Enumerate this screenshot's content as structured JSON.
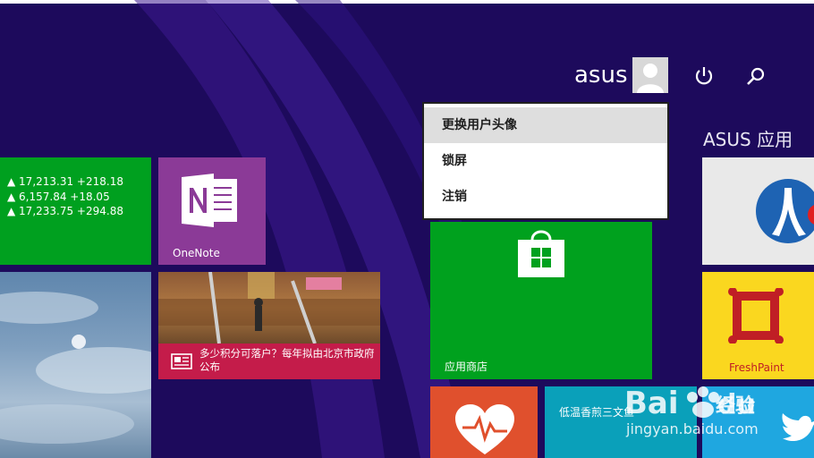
{
  "header": {
    "user_name": "asus",
    "power_icon": "power-icon",
    "search_icon": "search-icon"
  },
  "group_title": "ASUS 应用",
  "tiles": {
    "finance": {
      "rows": [
        "▲ 17,213.31 +218.18",
        "▲ 6,157.84 +18.05",
        "▲ 17,233.75 +294.88"
      ]
    },
    "onenote": {
      "label": "OneNote"
    },
    "news": {
      "text": "多少积分可落户？每年拟由北京市政府公布"
    },
    "store": {
      "label": "应用商店"
    },
    "food": {
      "label": "低温香煎三文鱼"
    },
    "freshpaint": {
      "label": "FreshPaint"
    }
  },
  "menu": {
    "items": [
      "更换用户头像",
      "锁屏",
      "注销"
    ]
  },
  "watermark": {
    "brand_cn": "经验",
    "url": "jingyan.baidu.com"
  },
  "colors": {
    "background": "#1d0a5c",
    "finance": "#00a01f",
    "onenote": "#8b3a97",
    "news": "#c41c4a",
    "store": "#00a11e",
    "health": "#e0502d",
    "food": "#0aa0ba",
    "freshpaint": "#fad71f",
    "twitter": "#1fa7e0"
  }
}
